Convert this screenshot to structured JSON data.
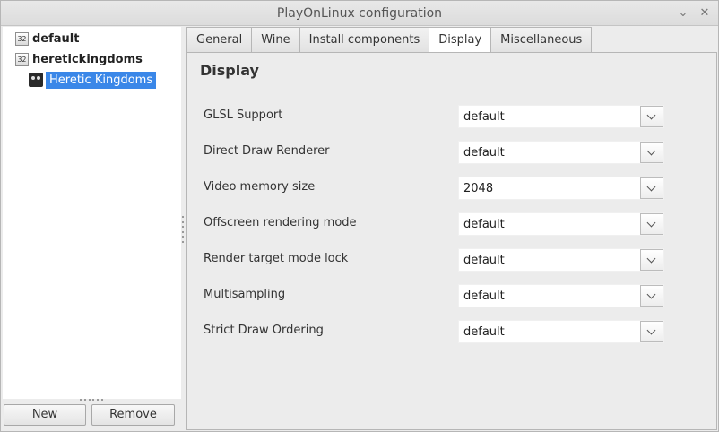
{
  "window": {
    "title": "PlayOnLinux configuration",
    "minimize_glyph": "⌄",
    "close_glyph": "✕"
  },
  "sidebar": {
    "items": [
      {
        "label": "default",
        "badge": "32",
        "type": "prefix"
      },
      {
        "label": "heretickingdoms",
        "badge": "32",
        "type": "prefix"
      },
      {
        "label": "Heretic Kingdoms",
        "type": "app",
        "selected": true
      }
    ],
    "new_label": "New",
    "remove_label": "Remove"
  },
  "tabs": [
    {
      "label": "General",
      "active": false
    },
    {
      "label": "Wine",
      "active": false
    },
    {
      "label": "Install components",
      "active": false
    },
    {
      "label": "Display",
      "active": true
    },
    {
      "label": "Miscellaneous",
      "active": false
    }
  ],
  "display": {
    "heading": "Display",
    "rows": [
      {
        "label": "GLSL Support",
        "value": "default"
      },
      {
        "label": "Direct Draw Renderer",
        "value": "default"
      },
      {
        "label": "Video memory size",
        "value": "2048"
      },
      {
        "label": "Offscreen rendering mode",
        "value": "default"
      },
      {
        "label": "Render target mode lock",
        "value": "default"
      },
      {
        "label": "Multisampling",
        "value": "default"
      },
      {
        "label": "Strict Draw Ordering",
        "value": "default"
      }
    ]
  },
  "colors": {
    "selection": "#3a87e8",
    "window_bg": "#ececec"
  }
}
